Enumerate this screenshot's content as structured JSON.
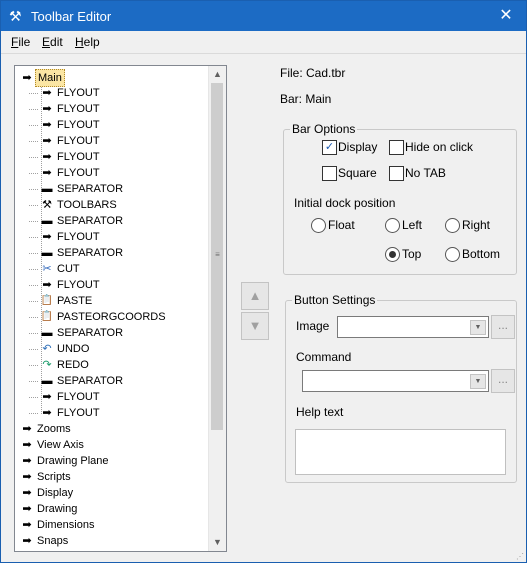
{
  "window": {
    "title": "Toolbar Editor",
    "close_glyph": "✕",
    "app_icon": "tools-icon"
  },
  "menu": [
    {
      "label": "File",
      "mnemonic": "F",
      "rest": "ile"
    },
    {
      "label": "Edit",
      "mnemonic": "E",
      "rest": "dit"
    },
    {
      "label": "Help",
      "mnemonic": "H",
      "rest": "elp"
    }
  ],
  "tree": {
    "items": [
      {
        "label": "Main",
        "icon": "arrow-right-icon",
        "glyph": "➡",
        "level": 0,
        "selected": true
      },
      {
        "label": "FLYOUT",
        "icon": "arrow-right-icon",
        "glyph": "➡",
        "level": 1
      },
      {
        "label": "FLYOUT",
        "icon": "arrow-right-icon",
        "glyph": "➡",
        "level": 1
      },
      {
        "label": "FLYOUT",
        "icon": "arrow-right-icon",
        "glyph": "➡",
        "level": 1
      },
      {
        "label": "FLYOUT",
        "icon": "arrow-right-icon",
        "glyph": "➡",
        "level": 1
      },
      {
        "label": "FLYOUT",
        "icon": "arrow-right-icon",
        "glyph": "➡",
        "level": 1
      },
      {
        "label": "FLYOUT",
        "icon": "arrow-right-icon",
        "glyph": "➡",
        "level": 1
      },
      {
        "label": "SEPARATOR",
        "icon": "separator-icon",
        "glyph": "▬",
        "level": 1
      },
      {
        "label": "TOOLBARS",
        "icon": "tools-icon",
        "glyph": "⚒",
        "level": 1
      },
      {
        "label": "SEPARATOR",
        "icon": "separator-icon",
        "glyph": "▬",
        "level": 1
      },
      {
        "label": "FLYOUT",
        "icon": "arrow-right-icon",
        "glyph": "➡",
        "level": 1
      },
      {
        "label": "SEPARATOR",
        "icon": "separator-icon",
        "glyph": "▬",
        "level": 1
      },
      {
        "label": "CUT",
        "icon": "scissors-icon",
        "glyph": "✂",
        "level": 1
      },
      {
        "label": "FLYOUT",
        "icon": "arrow-right-icon",
        "glyph": "➡",
        "level": 1
      },
      {
        "label": "PASTE",
        "icon": "clipboard-icon",
        "glyph": "📋",
        "level": 1
      },
      {
        "label": "PASTEORGCOORDS",
        "icon": "clipboard-icon",
        "glyph": "📋",
        "level": 1
      },
      {
        "label": "SEPARATOR",
        "icon": "separator-icon",
        "glyph": "▬",
        "level": 1
      },
      {
        "label": "UNDO",
        "icon": "undo-icon",
        "glyph": "↶",
        "level": 1
      },
      {
        "label": "REDO",
        "icon": "redo-icon",
        "glyph": "↷",
        "level": 1
      },
      {
        "label": "SEPARATOR",
        "icon": "separator-icon",
        "glyph": "▬",
        "level": 1
      },
      {
        "label": "FLYOUT",
        "icon": "arrow-right-icon",
        "glyph": "➡",
        "level": 1
      },
      {
        "label": "FLYOUT",
        "icon": "arrow-right-icon",
        "glyph": "➡",
        "level": 1
      },
      {
        "label": "Zooms",
        "icon": "arrow-right-icon",
        "glyph": "➡",
        "level": 0
      },
      {
        "label": "View Axis",
        "icon": "arrow-right-icon",
        "glyph": "➡",
        "level": 0
      },
      {
        "label": "Drawing Plane",
        "icon": "arrow-right-icon",
        "glyph": "➡",
        "level": 0
      },
      {
        "label": "Scripts",
        "icon": "arrow-right-icon",
        "glyph": "➡",
        "level": 0
      },
      {
        "label": "Display",
        "icon": "arrow-right-icon",
        "glyph": "➡",
        "level": 0
      },
      {
        "label": "Drawing",
        "icon": "arrow-right-icon",
        "glyph": "➡",
        "level": 0
      },
      {
        "label": "Dimensions",
        "icon": "arrow-right-icon",
        "glyph": "➡",
        "level": 0
      },
      {
        "label": "Snaps",
        "icon": "arrow-right-icon",
        "glyph": "➡",
        "level": 0
      }
    ]
  },
  "move_buttons": {
    "up_glyph": "▲",
    "down_glyph": "▼"
  },
  "info": {
    "file": "File: Cad.tbr",
    "bar": "Bar: Main"
  },
  "bar_options": {
    "title": "Bar Options",
    "display": {
      "label": "Display",
      "checked": true,
      "glyph": "✓"
    },
    "hide_on_click": {
      "label": "Hide on click",
      "checked": false
    },
    "square": {
      "label": "Square",
      "checked": false
    },
    "no_tab": {
      "label": "No TAB",
      "checked": false
    },
    "dock_label": "Initial dock position",
    "dock": {
      "float": "Float",
      "left": "Left",
      "right": "Right",
      "top": "Top",
      "bottom": "Bottom",
      "selected": "Top"
    }
  },
  "button_settings": {
    "title": "Button Settings",
    "image_label": "Image",
    "image_value": "",
    "command_label": "Command",
    "command_value": "",
    "help_label": "Help text",
    "help_value": "",
    "browse_glyph": "...",
    "dropdown_glyph": "▼"
  }
}
